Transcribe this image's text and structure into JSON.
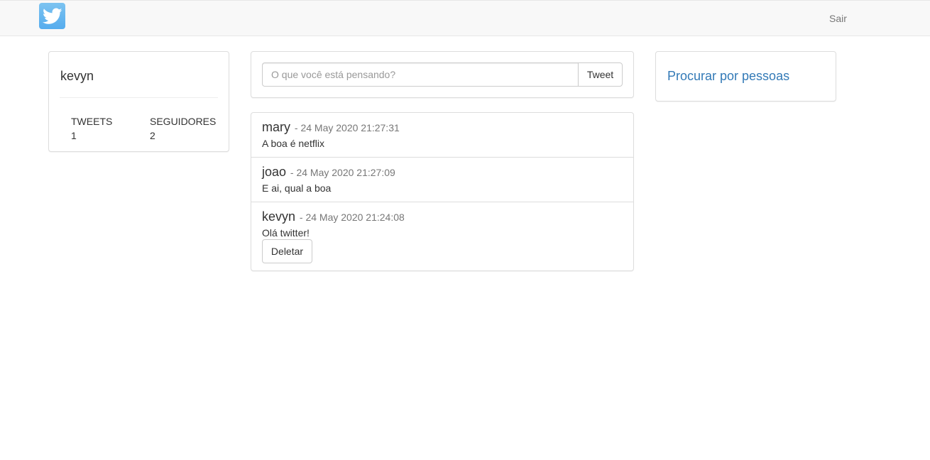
{
  "navbar": {
    "logo_icon": "twitter-bird-icon",
    "logout_label": "Sair"
  },
  "profile": {
    "username": "kevyn",
    "stats": [
      {
        "label": "TWEETS",
        "value": "1"
      },
      {
        "label": "SEGUIDORES",
        "value": "2"
      }
    ]
  },
  "compose": {
    "placeholder": "O que você está pensando?",
    "value": "",
    "button_label": "Tweet"
  },
  "feed": {
    "tweets": [
      {
        "author": "mary",
        "date": "- 24 May 2020 21:27:31",
        "text": "A boa é netflix"
      },
      {
        "author": "joao",
        "date": "- 24 May 2020 21:27:09",
        "text": "E ai, qual a boa"
      },
      {
        "author": "kevyn",
        "date": "- 24 May 2020 21:24:08",
        "text": "Olá twitter!",
        "delete_label": "Deletar"
      }
    ]
  },
  "search": {
    "label": "Procurar por pessoas"
  },
  "colors": {
    "navbar_bg": "#f8f8f8",
    "logo_blue": "#55acee",
    "link_blue": "#337ab7",
    "muted_text": "#777777",
    "border": "#dddddd"
  }
}
